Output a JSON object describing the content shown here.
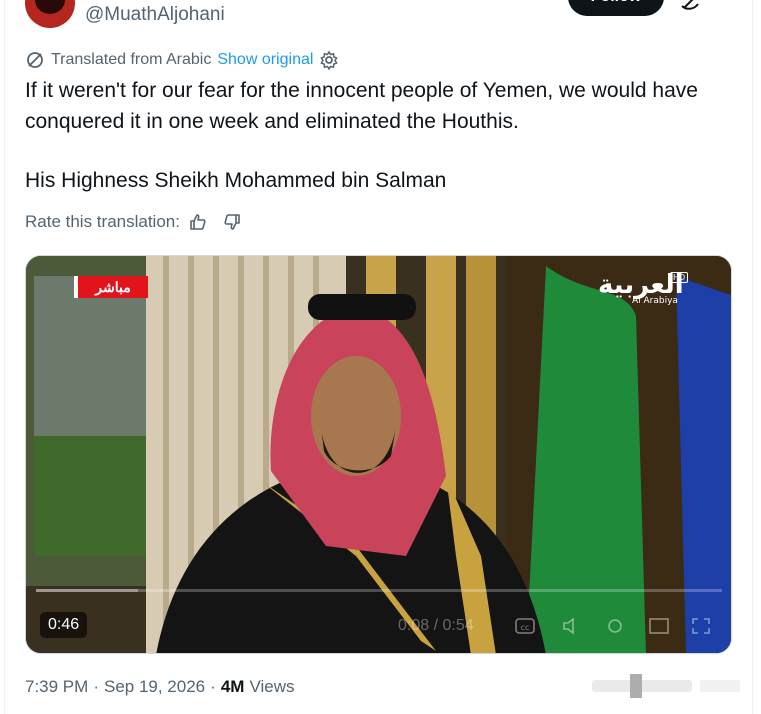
{
  "header": {
    "handle": "@MuathAljohani",
    "follow_label": "Follow"
  },
  "translation": {
    "label": "Translated from Arabic",
    "show_original": "Show original"
  },
  "tweet": {
    "text": "If it weren't for our fear for the innocent people of Yemen, we would have conquered it in one week and eliminated the Houthis.",
    "signature": "His Highness Sheikh Mohammed bin Salman"
  },
  "rate": {
    "label": "Rate this translation:"
  },
  "video": {
    "live_badge": "مباشر",
    "channel_logo": "العربية",
    "channel_logo_en": "Al Arabiya",
    "channel_hd": "HD",
    "duration": "0:46",
    "playback_time": "0:08 / 0:54",
    "progress_fraction": 0.148
  },
  "meta": {
    "time": "7:39 PM",
    "separator": "·",
    "date": "Sep 19, 2026",
    "views_count": "4M",
    "views_label": "Views"
  },
  "colors": {
    "accent": "#1d9bf0",
    "text": "#0f1419",
    "secondary": "#536471",
    "live_red": "#e0141a"
  }
}
